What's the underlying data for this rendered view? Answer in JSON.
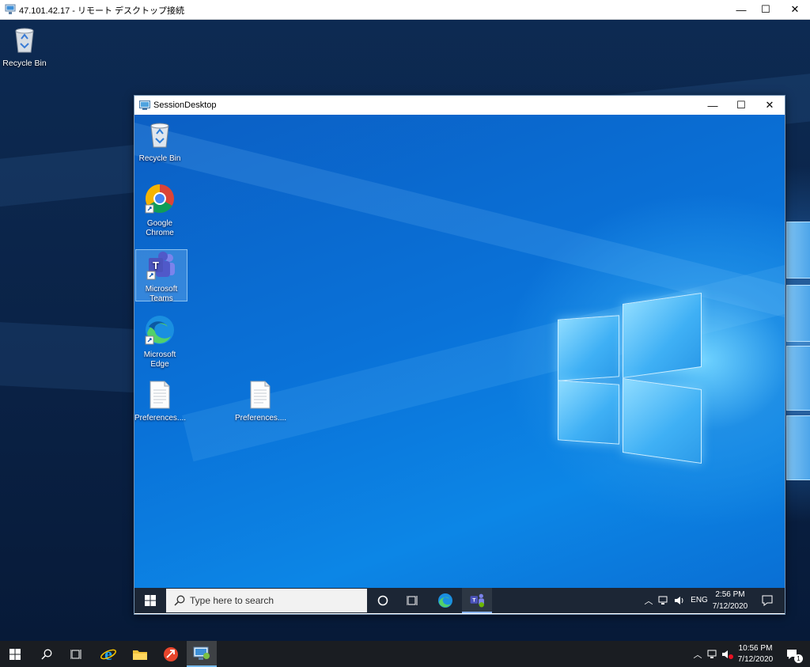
{
  "rdp_window": {
    "title": "47.101.42.17 - リモート デスクトップ接続",
    "minimize_glyph": "—",
    "maximize_glyph": "☐",
    "close_glyph": "✕"
  },
  "outer_desktop": {
    "icons": [
      {
        "label": "Recycle Bin",
        "icon": "recycle-bin-icon"
      }
    ]
  },
  "session_window": {
    "title": "SessionDesktop",
    "minimize_glyph": "—",
    "maximize_glyph": "☐",
    "close_glyph": "✕"
  },
  "inner_desktop": {
    "icons": [
      {
        "label": "Recycle Bin",
        "icon": "recycle-bin-icon"
      },
      {
        "label": "Google Chrome",
        "icon": "chrome-icon"
      },
      {
        "label": "Microsoft Teams",
        "icon": "teams-icon"
      },
      {
        "label": "Microsoft Edge",
        "icon": "edge-icon"
      },
      {
        "label": "Preferences....",
        "icon": "document-icon"
      },
      {
        "label": "Preferences....",
        "icon": "document-icon"
      }
    ]
  },
  "inner_taskbar": {
    "search_placeholder": "Type here to search",
    "language": "ENG",
    "time": "2:56 PM",
    "date": "7/12/2020",
    "pinned": [
      "cortana-icon",
      "task-view-icon",
      "edge-icon",
      "teams-icon"
    ]
  },
  "outer_taskbar": {
    "time": "10:56 PM",
    "date": "7/12/2020",
    "notification_count": "1",
    "pinned": [
      "search-icon",
      "task-view-icon",
      "internet-explorer-icon",
      "file-explorer-icon",
      "remote-app-icon",
      "remote-desktop-icon"
    ]
  },
  "colors": {
    "inner_accent": "#0a72d8",
    "outer_background": "#0b2344",
    "taskbar": "#1a1d22"
  }
}
